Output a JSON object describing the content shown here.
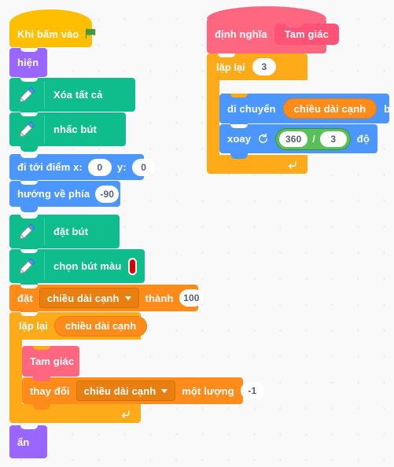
{
  "workspace": {
    "name": "scratch-block-workspace",
    "background_color": "#f9f9f9",
    "grid_dot_color": "#e9e9e9"
  },
  "colors": {
    "events": "#ffbf00",
    "looks": "#9966ff",
    "pen": "#0fbd8c",
    "motion": "#4c97ff",
    "variables": "#ff8c1a",
    "control": "#ffab19",
    "custom_block": "#ff6680",
    "operators": "#59c059",
    "pen_swatch": "#dd0000",
    "flag_green": "#45993d"
  },
  "main_script": {
    "name": "main-script",
    "hat": {
      "label": "Khi bấm vào",
      "icon": "green-flag-icon"
    },
    "blocks": [
      {
        "id": "show",
        "label": "hiện",
        "category": "looks"
      },
      {
        "id": "erase-all",
        "label": "Xóa tất cả",
        "category": "pen",
        "icon": "pen-icon"
      },
      {
        "id": "pen-up",
        "label": "nhấc bút",
        "category": "pen",
        "icon": "pen-icon"
      },
      {
        "id": "goto-xy",
        "label_x": "đi tới điểm x:",
        "value_x": "0",
        "label_y": "y:",
        "value_y": "0",
        "category": "motion"
      },
      {
        "id": "point-direction",
        "label": "hướng về phía",
        "value": "-90",
        "category": "motion"
      },
      {
        "id": "pen-down",
        "label": "đặt bút",
        "category": "pen",
        "icon": "pen-icon"
      },
      {
        "id": "set-pen-color",
        "label": "chọn bút màu",
        "swatch": "#dd0000",
        "category": "pen",
        "icon": "pen-icon"
      },
      {
        "id": "set-variable",
        "label_prefix": "đặt",
        "variable": "chiều dài cạnh",
        "label_mid": "thành",
        "value": "100",
        "category": "variables"
      },
      {
        "id": "repeat-loop",
        "label": "lặp lại",
        "times_variable": "chiều dài cạnh",
        "category": "control"
      },
      {
        "id": "call-triangle",
        "label": "Tam giác",
        "category": "custom_block"
      },
      {
        "id": "change-variable",
        "label_prefix": "thay đổi",
        "variable": "chiều dài cạnh",
        "label_mid": "một lượng",
        "value": "-1",
        "category": "variables"
      },
      {
        "id": "hide",
        "label": "ẩn",
        "category": "looks"
      }
    ]
  },
  "definition_script": {
    "name": "triangle-definition-script",
    "hat": {
      "label_prefix": "định nghĩa",
      "proc_name": "Tam giác"
    },
    "blocks": [
      {
        "id": "repeat-3",
        "label": "lặp lại",
        "value": "3",
        "category": "control"
      },
      {
        "id": "move-steps",
        "label_prefix": "di chuyển",
        "variable": "chiều dài cạnh",
        "label_suffix": "bước",
        "category": "motion"
      },
      {
        "id": "turn-right",
        "label_prefix": "xoay",
        "icon": "turn-clockwise-icon",
        "operand_left": "360",
        "operator": "/",
        "operand_right": "3",
        "label_suffix": "độ",
        "category": "motion"
      }
    ]
  }
}
